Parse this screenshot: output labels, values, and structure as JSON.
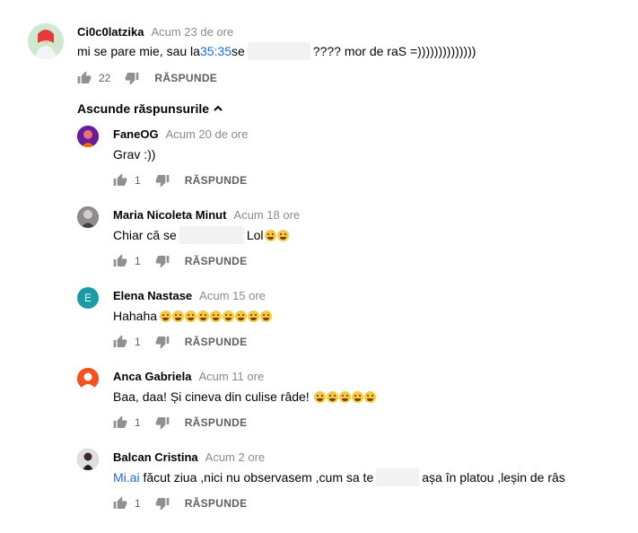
{
  "top_comment": {
    "author": "Ci0c0latzika",
    "time": "Acum 23 de ore",
    "text_before": "mi se pare mie, sau la ",
    "timestamp_link": "35:35",
    "text_mid": " se",
    "text_after": "???? mor de raS =))))))))))))))",
    "likes": "22",
    "reply_label": "RĂSPUNDE"
  },
  "replies_toggle": {
    "label": "Ascunde răspunsurile"
  },
  "replies": [
    {
      "author": "FaneOG",
      "time": "Acum 20 de ore",
      "text": "Grav :))",
      "likes": "1",
      "reply_label": "RĂSPUNDE",
      "avatar_color": "#7b1fa2"
    },
    {
      "author": "Maria Nicoleta Minut",
      "time": "Acum 18 ore",
      "text_before": "Chiar că se",
      "text_after": " Lol",
      "likes": "1",
      "reply_label": "RĂSPUNDE",
      "avatar_color": "#6d6d6d"
    },
    {
      "author": "Elena Nastase",
      "time": "Acum 15 ore",
      "text": "Hahaha",
      "avatar_letter": "E",
      "likes": "1",
      "reply_label": "RĂSPUNDE",
      "avatar_color": "#1a9ba6"
    },
    {
      "author": "Anca Gabriela",
      "time": "Acum 11 ore",
      "text": "Baa, daa! Și cineva din culise râde!",
      "likes": "1",
      "reply_label": "RĂSPUNDE",
      "avatar_color": "#f4511e"
    },
    {
      "author": "Balcan Cristina",
      "time": "Acum 2 ore",
      "text_link": "Mi.ai",
      "text_before": " făcut ziua ,nici nu observasem ,cum sa te",
      "text_after": "așa în platou ,leșin de râs",
      "likes": "1",
      "reply_label": "RĂSPUNDE",
      "avatar_color": "#3a3a3a"
    }
  ],
  "icons": {
    "like": "thumbs-up-icon",
    "dislike": "thumbs-down-icon",
    "chevron": "chevron-up-icon"
  }
}
